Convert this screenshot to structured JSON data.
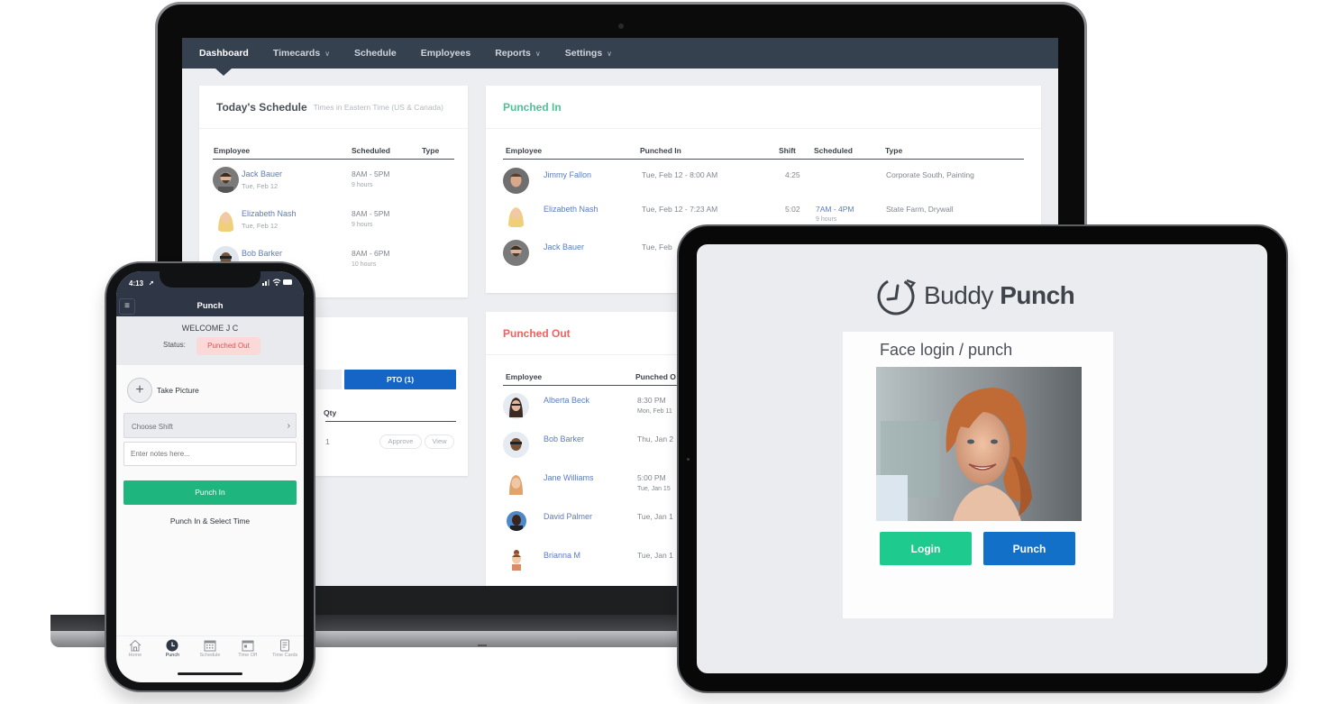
{
  "laptop": {
    "nav": [
      {
        "label": "Dashboard",
        "active": true,
        "dropdown": false
      },
      {
        "label": "Timecards",
        "active": false,
        "dropdown": true
      },
      {
        "label": "Schedule",
        "active": false,
        "dropdown": false
      },
      {
        "label": "Employees",
        "active": false,
        "dropdown": false
      },
      {
        "label": "Reports",
        "active": false,
        "dropdown": true
      },
      {
        "label": "Settings",
        "active": false,
        "dropdown": true
      }
    ],
    "todays_schedule": {
      "title": "Today's Schedule",
      "subtitle": "Times in Eastern Time (US & Canada)",
      "columns": [
        "Employee",
        "Scheduled",
        "Type"
      ],
      "rows": [
        {
          "name": "Jack Bauer",
          "date": "Tue, Feb 12",
          "scheduled": "8AM - 5PM",
          "hours": "9 hours"
        },
        {
          "name": "Elizabeth Nash",
          "date": "Tue, Feb 12",
          "scheduled": "8AM - 5PM",
          "hours": "9 hours"
        },
        {
          "name": "Bob Barker",
          "date": "",
          "scheduled": "8AM - 6PM",
          "hours": "10 hours"
        }
      ]
    },
    "punched_in": {
      "title": "Punched In",
      "columns": [
        "Employee",
        "Punched In",
        "Shift",
        "Scheduled",
        "Type"
      ],
      "rows": [
        {
          "name": "Jimmy Fallon",
          "punched_in": "Tue, Feb 12 - 8:00 AM",
          "shift": "4:25",
          "scheduled": "",
          "hours": "",
          "type": "Corporate South, Painting"
        },
        {
          "name": "Elizabeth Nash",
          "punched_in": "Tue, Feb 12 - 7:23 AM",
          "shift": "5:02",
          "scheduled": "7AM - 4PM",
          "hours": "9 hours",
          "type": "State Farm, Drywall"
        },
        {
          "name": "Jack Bauer",
          "punched_in": "Tue, Feb",
          "shift": "",
          "scheduled": "",
          "hours": "",
          "type": ""
        }
      ]
    },
    "punched_out": {
      "title": "Punched Out",
      "columns": [
        "Employee",
        "Punched O"
      ],
      "rows": [
        {
          "name": "Alberta Beck",
          "time": "8:30 PM",
          "date": "Mon, Feb 11"
        },
        {
          "name": "Bob Barker",
          "time": "Thu, Jan 2",
          "date": ""
        },
        {
          "name": "Jane Williams",
          "time": "5:00 PM",
          "date": "Tue, Jan 15"
        },
        {
          "name": "David Palmer",
          "time": "Tue, Jan 1",
          "date": ""
        },
        {
          "name": "Brianna M",
          "time": "Tue, Jan 1",
          "date": ""
        }
      ]
    },
    "pto": {
      "tab_label": "PTO (1)",
      "column": "Qty",
      "qty": "1",
      "approve_label": "Approve",
      "view_label": "View"
    }
  },
  "phone": {
    "time": "4:13",
    "status_icons": "signal wifi battery",
    "title": "Punch",
    "welcome": "WELCOME J C",
    "status_label": "Status:",
    "status_value": "Punched Out",
    "take_picture": "Take Picture",
    "choose_shift": "Choose Shift",
    "notes_placeholder": "Enter notes here...",
    "punch_in": "Punch In",
    "punch_select_time": "Punch In & Select Time",
    "tabs": [
      {
        "label": "Home",
        "icon": "home-icon",
        "active": false
      },
      {
        "label": "Punch",
        "icon": "clock-icon",
        "active": true
      },
      {
        "label": "Schedule",
        "icon": "calendar-grid-icon",
        "active": false
      },
      {
        "label": "Time Off",
        "icon": "calendar-icon",
        "active": false
      },
      {
        "label": "Time Cards",
        "icon": "document-icon",
        "active": false
      }
    ]
  },
  "tablet": {
    "logo_light": "Buddy",
    "logo_bold": "Punch",
    "face_title": "Face login / punch",
    "login_label": "Login",
    "punch_label": "Punch"
  },
  "colors": {
    "nav_bg": "#364150",
    "green": "#1fca8e",
    "blue": "#1370c8",
    "punched_in_title": "#4fc295",
    "punched_out_title": "#ef6262",
    "link": "#5a7cc0"
  }
}
